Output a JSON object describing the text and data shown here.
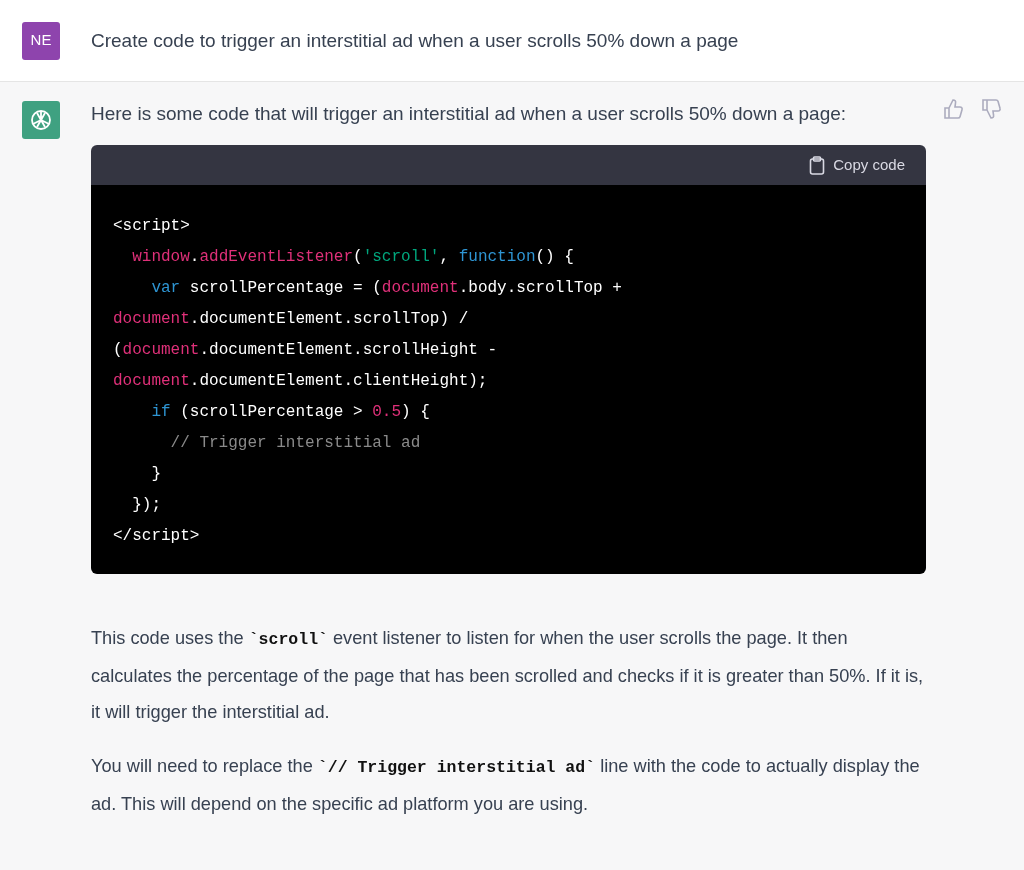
{
  "user_message": {
    "avatar": "NE",
    "text": "Create code to trigger an interstitial ad when a user scrolls 50% down a page"
  },
  "assistant_message": {
    "intro": "Here is some code that will trigger an interstitial ad when a user scrolls 50% down a page:",
    "code_block": {
      "copy_label": "Copy code",
      "lines": [
        {
          "kind": "flush",
          "tokens": [
            {
              "kind": "plain",
              "text": "<script>"
            }
          ]
        },
        {
          "kind": "indent1",
          "tokens": [
            {
              "kind": "name",
              "text": "window"
            },
            {
              "kind": "plain",
              "text": "."
            },
            {
              "kind": "name",
              "text": "addEventListener"
            },
            {
              "kind": "plain",
              "text": "("
            },
            {
              "kind": "string",
              "text": "'scroll'"
            },
            {
              "kind": "plain",
              "text": ", "
            },
            {
              "kind": "keyword",
              "text": "function"
            },
            {
              "kind": "plain",
              "text": "() {"
            }
          ]
        },
        {
          "kind": "indent2",
          "tokens": [
            {
              "kind": "keyword",
              "text": "var"
            },
            {
              "kind": "plain",
              "text": " scrollPercentage = ("
            },
            {
              "kind": "name",
              "text": "document"
            },
            {
              "kind": "plain",
              "text": ".body.scrollTop +"
            }
          ]
        },
        {
          "kind": "flush",
          "tokens": [
            {
              "kind": "name",
              "text": "document"
            },
            {
              "kind": "plain",
              "text": ".documentElement.scrollTop) /"
            }
          ]
        },
        {
          "kind": "flush",
          "tokens": [
            {
              "kind": "plain",
              "text": "("
            },
            {
              "kind": "name",
              "text": "document"
            },
            {
              "kind": "plain",
              "text": ".documentElement.scrollHeight -"
            }
          ]
        },
        {
          "kind": "flush",
          "tokens": [
            {
              "kind": "name",
              "text": "document"
            },
            {
              "kind": "plain",
              "text": ".documentElement.clientHeight);"
            }
          ]
        },
        {
          "kind": "indent2",
          "tokens": [
            {
              "kind": "keyword",
              "text": "if"
            },
            {
              "kind": "plain",
              "text": " (scrollPercentage > "
            },
            {
              "kind": "number",
              "text": "0.5"
            },
            {
              "kind": "plain",
              "text": ") {"
            }
          ]
        },
        {
          "kind": "indent3",
          "tokens": [
            {
              "kind": "comment",
              "text": "// Trigger interstitial ad"
            }
          ]
        },
        {
          "kind": "indent2",
          "tokens": [
            {
              "kind": "plain",
              "text": "}"
            }
          ]
        },
        {
          "kind": "indent1",
          "tokens": [
            {
              "kind": "plain",
              "text": "});"
            }
          ]
        },
        {
          "kind": "flush",
          "tokens": [
            {
              "kind": "plain",
              "text": "</script>"
            }
          ]
        }
      ]
    },
    "paragraphs": [
      [
        {
          "kind": "text",
          "text": "This code uses the "
        },
        {
          "kind": "code",
          "text": "`scroll`"
        },
        {
          "kind": "text",
          "text": " event listener to listen for when the user scrolls the page. It then calculates the percentage of the page that has been scrolled and checks if it is greater than 50%. If it is, it will trigger the interstitial ad."
        }
      ],
      [
        {
          "kind": "text",
          "text": "You will need to replace the "
        },
        {
          "kind": "code",
          "text": "`// Trigger interstitial ad`"
        },
        {
          "kind": "text",
          "text": " line with the code to actually display the ad. This will depend on the specific ad platform you are using."
        }
      ]
    ]
  }
}
